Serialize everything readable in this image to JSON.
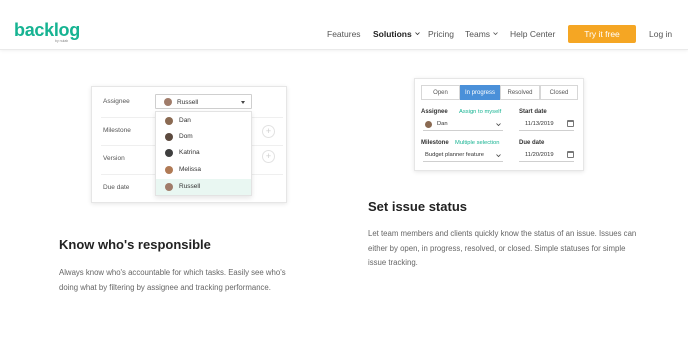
{
  "header": {
    "logo_text": "backlog",
    "logo_sub": "by nulab",
    "nav": {
      "features": "Features",
      "solutions": "Solutions",
      "pricing": "Pricing",
      "teams": "Teams",
      "help_center": "Help Center",
      "login": "Log in"
    },
    "cta_label": "Try it free"
  },
  "assignee_card": {
    "labels": {
      "assignee": "Assignee",
      "milestone": "Milestone",
      "version": "Version",
      "due_date": "Due date"
    },
    "selected": "Russell",
    "dropdown_items": [
      {
        "name": "Dan",
        "avatar_color": "#8a6a52"
      },
      {
        "name": "Dom",
        "avatar_color": "#5c4a3f"
      },
      {
        "name": "Katrina",
        "avatar_color": "#3f3f3f"
      },
      {
        "name": "Melissa",
        "avatar_color": "#b07a55"
      },
      {
        "name": "Russell",
        "avatar_color": "#a07c6a"
      }
    ],
    "highlighted_item": "Russell"
  },
  "status_card": {
    "tabs": [
      "Open",
      "In progress",
      "Resolved",
      "Closed"
    ],
    "active_tab": "In progress",
    "assignee_label": "Assignee",
    "assign_to_myself": "Assign to myself",
    "assignee_value": "Dan",
    "start_date_label": "Start date",
    "start_date_value": "11/13/2019",
    "milestone_label": "Milestone",
    "multiple_selection": "Multiple selection",
    "milestone_value": "Budget planner feature",
    "due_date_label": "Due date",
    "due_date_value": "11/20/2019"
  },
  "sections": {
    "status": {
      "title": "Set issue status",
      "body": "Let team members and clients quickly know the status of an issue. Issues can either by open, in progress, resolved, or closed. Simple statuses for simple issue tracking."
    },
    "responsible": {
      "title": "Know who's responsible",
      "body": "Always know who's accountable for which tasks. Easily see who's doing what by filtering by assignee and tracking performance."
    }
  },
  "colors": {
    "brand": "#16b392",
    "cta": "#f5a623",
    "active_tab": "#4a90d9"
  }
}
